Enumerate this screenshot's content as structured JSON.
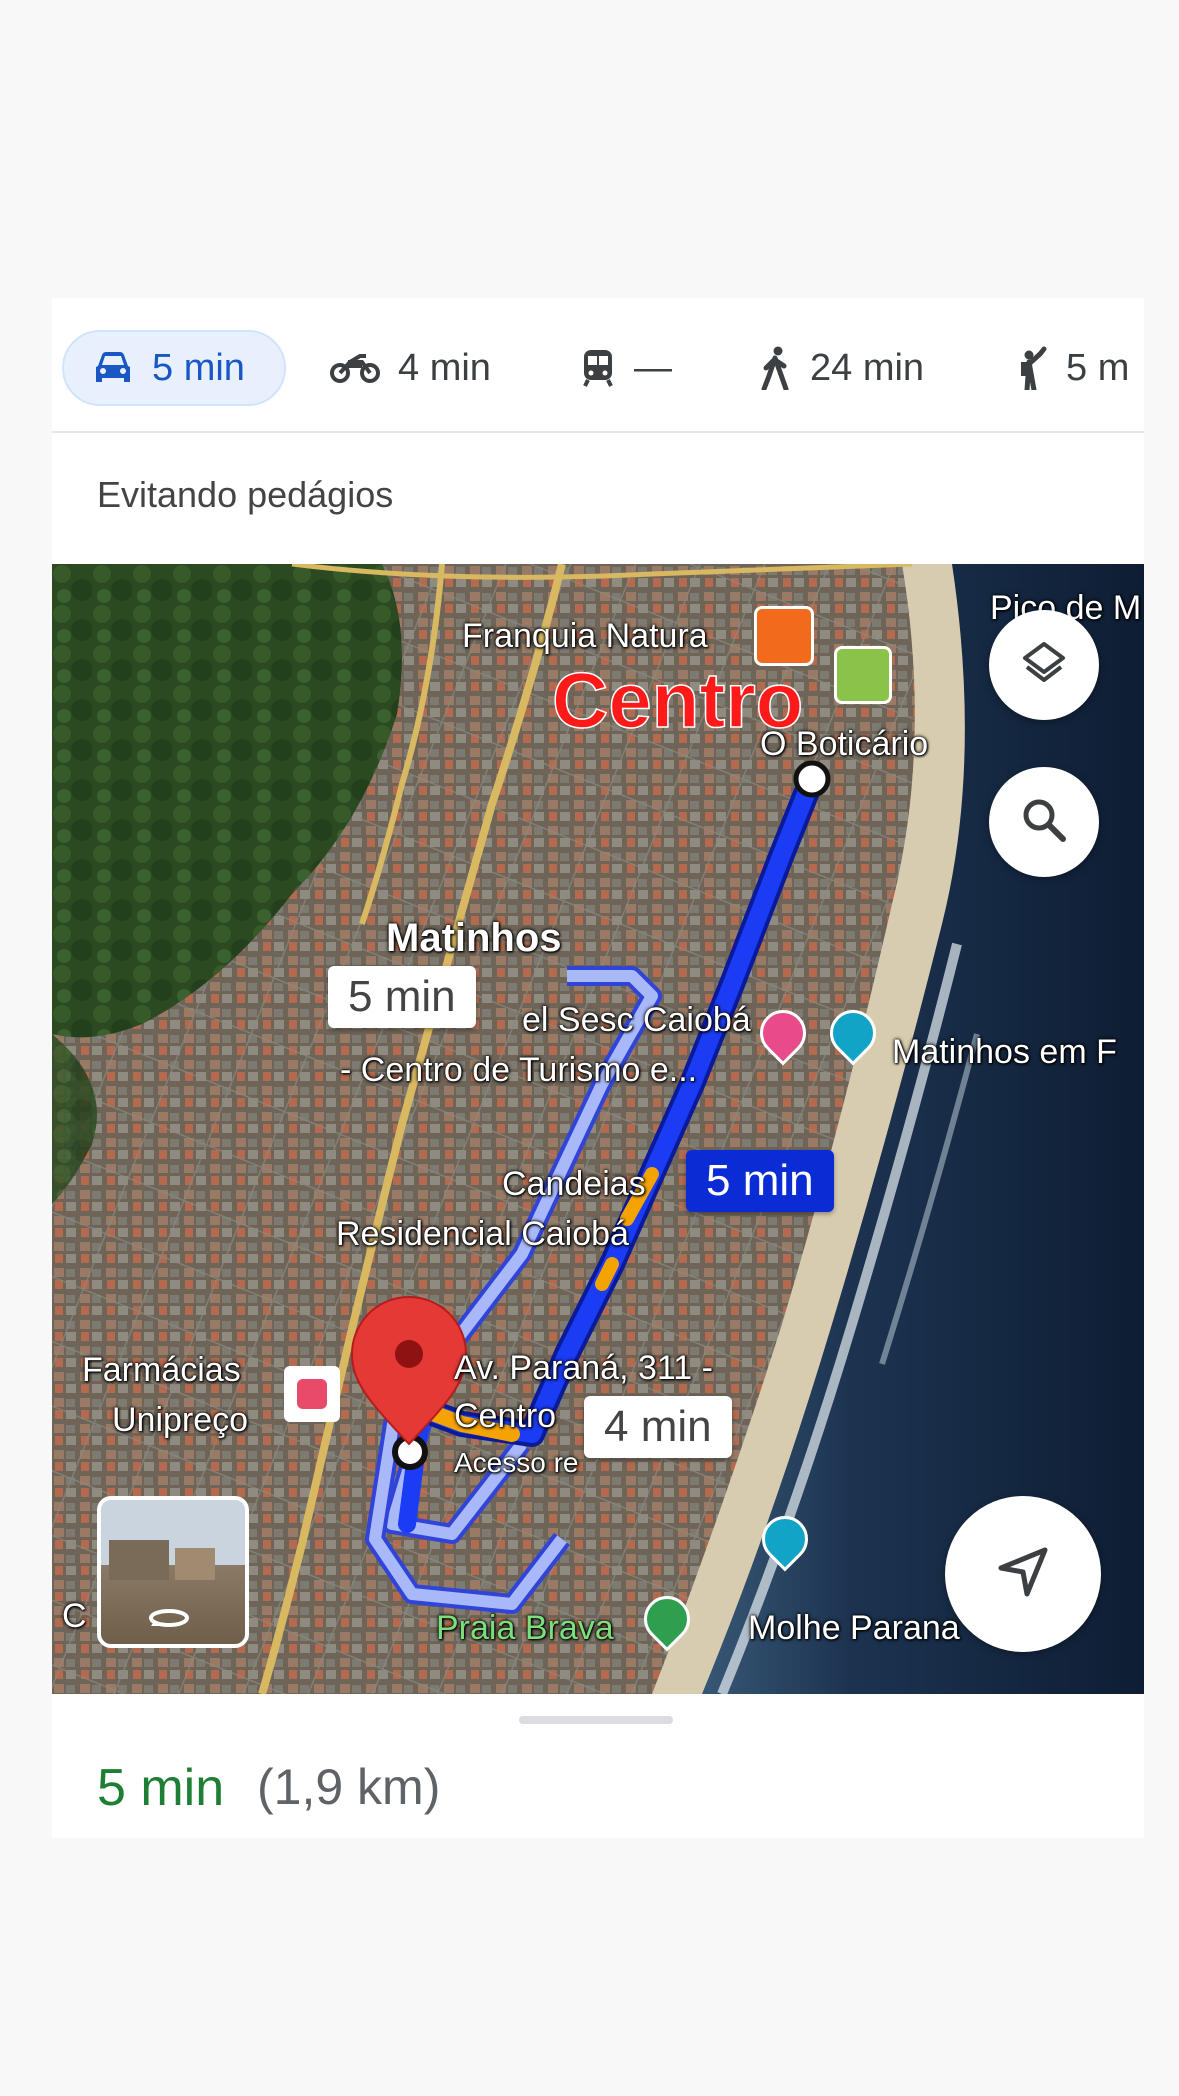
{
  "modes": [
    {
      "icon": "car-icon",
      "label": "5 min",
      "active": true
    },
    {
      "icon": "motorcycle-icon",
      "label": "4 min"
    },
    {
      "icon": "transit-icon",
      "label": "—"
    },
    {
      "icon": "walk-icon",
      "label": "24 min"
    },
    {
      "icon": "ride-hail-icon",
      "label": "5 m"
    }
  ],
  "route_option": "Evitando pedágios",
  "map": {
    "places": {
      "natura": "Franquia Natura",
      "centro": "Centro",
      "boticario": "O Boticário",
      "pico": "Pico de M",
      "matinhos": "Matinhos",
      "sesc1": "el Sesc Caiobá",
      "sesc2": "- Centro de Turismo e...",
      "matinhos_em": "Matinhos em F",
      "candeias": "Candeias",
      "residencial": "Residencial Caiobá",
      "farmacias1": "Farmácias",
      "farmacias2": "Unipreço",
      "dest1": "Av. Paraná, 311 -",
      "dest2": "Centro",
      "dest3": "Acesso re",
      "praia": "Praia Brava",
      "molhe": "Molhe Parana",
      "c_partial": "C"
    },
    "route_labels": {
      "alt1": "5 min",
      "main": "5 min",
      "alt2": "4 min"
    },
    "colors": {
      "route_main": "#1a3cf5",
      "route_alt": "#a8b8f8",
      "traffic": "#f5a300",
      "pin": "#e53935"
    }
  },
  "summary": {
    "time": "5 min",
    "distance": "(1,9 km)"
  }
}
